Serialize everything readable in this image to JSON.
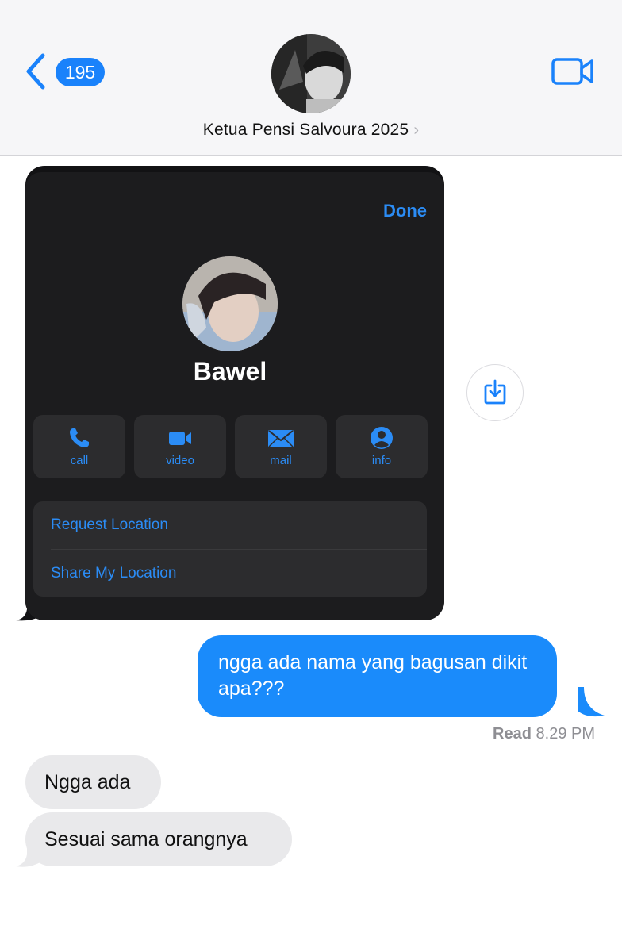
{
  "header": {
    "back_count": "195",
    "contact_name": "Ketua Pensi Salvoura 2025",
    "chevron": "›",
    "icons": {
      "back": "chevron-left-icon",
      "video": "video-camera-icon"
    }
  },
  "contact_card": {
    "done_label": "Done",
    "name": "Bawel",
    "actions": [
      {
        "label": "call",
        "icon": "phone-icon"
      },
      {
        "label": "video",
        "icon": "video-icon"
      },
      {
        "label": "mail",
        "icon": "mail-icon"
      },
      {
        "label": "info",
        "icon": "person-icon"
      }
    ],
    "location_options": [
      "Request Location",
      "Share My Location"
    ],
    "save_icon": "download-icon"
  },
  "messages": {
    "outgoing": [
      {
        "text": "ngga ada nama yang bagusan dikit apa???"
      }
    ],
    "read_status": "Read",
    "read_time": "8.29 PM",
    "incoming": [
      {
        "text": "Ngga ada"
      },
      {
        "text": "Sesuai sama orangnya"
      }
    ]
  },
  "colors": {
    "accent": "#1a82fb",
    "outgoing_bubble": "#1a8bfb",
    "incoming_bubble": "#e9e9eb",
    "card_bg": "#1c1c1e",
    "card_button_bg": "#2c2c2e",
    "link_blue": "#2b8cf5"
  }
}
